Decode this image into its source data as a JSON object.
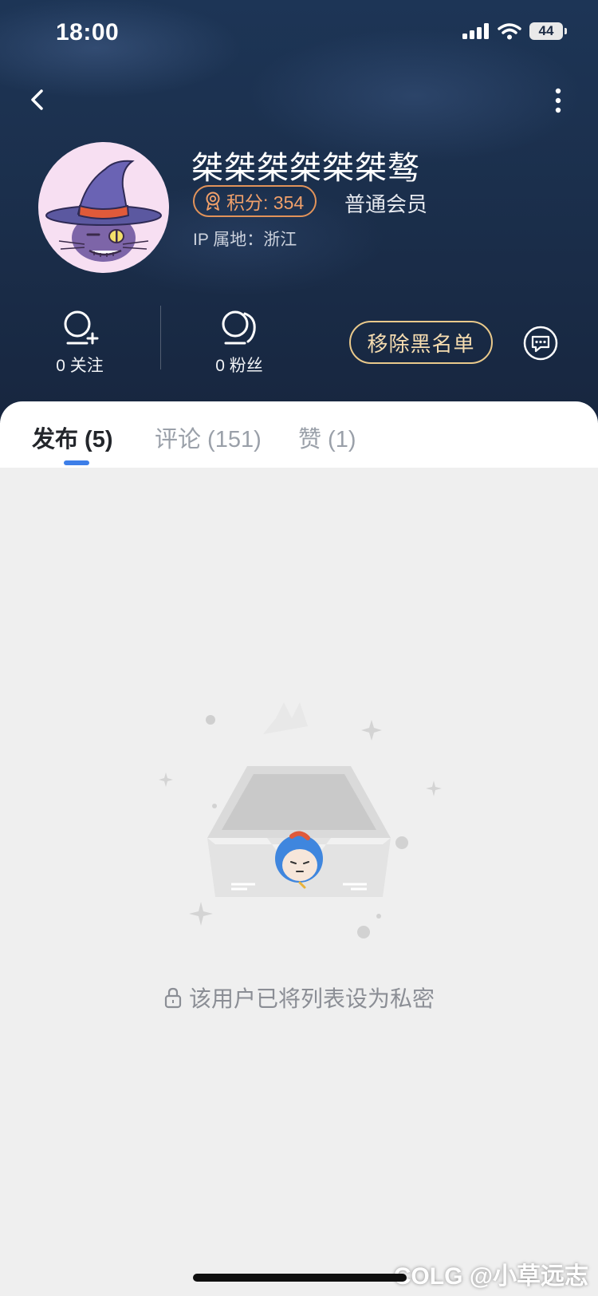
{
  "status_bar": {
    "time": "18:00",
    "battery": "44"
  },
  "profile": {
    "username": "桀桀桀桀桀桀骜",
    "points_label": "积分: 354",
    "member_level": "普通会员",
    "ip_location": "IP 属地：浙江"
  },
  "stats": {
    "following": "0 关注",
    "followers": "0 粉丝"
  },
  "actions": {
    "remove_blacklist": "移除黑名单"
  },
  "tabs": [
    {
      "label": "发布 (5)",
      "active": true
    },
    {
      "label": "评论 (151)",
      "active": false
    },
    {
      "label": "赞 (1)",
      "active": false
    }
  ],
  "empty_state": {
    "message": "该用户已将列表设为私密"
  },
  "watermark": "COLG @小草远志",
  "colors": {
    "accent_blue": "#3d7ee8",
    "badge_orange": "#e2935a",
    "gold_button": "#e9c98b",
    "header_bg": "#1b2f4c"
  },
  "icons": [
    "back-icon",
    "more-icon",
    "follow-icon",
    "followers-icon",
    "message-icon",
    "medal-icon",
    "lock-icon",
    "signal-icon",
    "wifi-icon"
  ]
}
